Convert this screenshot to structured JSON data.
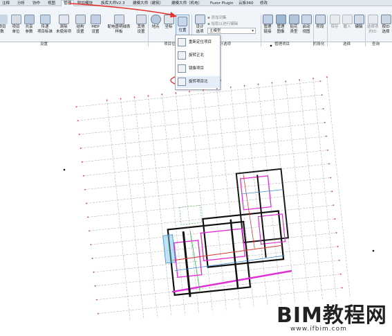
{
  "ribbon": {
    "tabs": [
      "注释",
      "分析",
      "协作",
      "视图",
      "管理",
      "附加模块",
      "族库大师V2.3",
      "建模大师（建筑）",
      "建模大师（机电）",
      "Fuzor Plugin",
      "云族360",
      "修改"
    ],
    "active_tab": "管理",
    "buttons": {
      "project_info": "项目\n数",
      "project_units": "项目\n单位",
      "shared_params": "共享\n参数",
      "transfer_standards": "传递\n项目标准",
      "purge_unused": "清除\n未使用项",
      "structural_settings": "结构\n设置",
      "mep_settings": "MEP\n设置",
      "panel_schedule_templates": "配电盘明细表\n样板",
      "other_settings": "其他\n设置",
      "location": "地点",
      "coordinates": "坐标",
      "position": "位置",
      "design_options": "设计\n选项",
      "manage_links": "管理\n链接",
      "manage_images": "管理\n图像",
      "decal_types": "贴花\n类型",
      "starting_view": "启动\n视图",
      "phases": "阶段",
      "save_selection": "保存",
      "load_selection": "载入",
      "edit_selection": "编辑",
      "select_by_id": "选择项\n的ID",
      "ids_of_selection": "按ID\n选择"
    },
    "small_items": {
      "add_to_set": "添加到集",
      "pick_to_edit": "拾取以进行编辑",
      "main_model": "主模型"
    },
    "panels": {
      "settings": "设置",
      "project_location": "项目位置",
      "design_options": "设计选项",
      "manage_project": "管理项目",
      "phasing": "阶段化",
      "selection": "选择",
      "inquiry": "查询"
    }
  },
  "dropdown": {
    "items": [
      "重新定位项目",
      "旋转正北",
      "镜像项目",
      "旋转项目北"
    ],
    "highlighted_index": 3
  },
  "watermark": {
    "brand": "BIM教程网",
    "url": "www.ifbim.com"
  },
  "colors": {
    "annotation_red": "#e8302a",
    "ribbon_bg": "#f1f4f8",
    "grid_line": "#a8a8a8"
  }
}
